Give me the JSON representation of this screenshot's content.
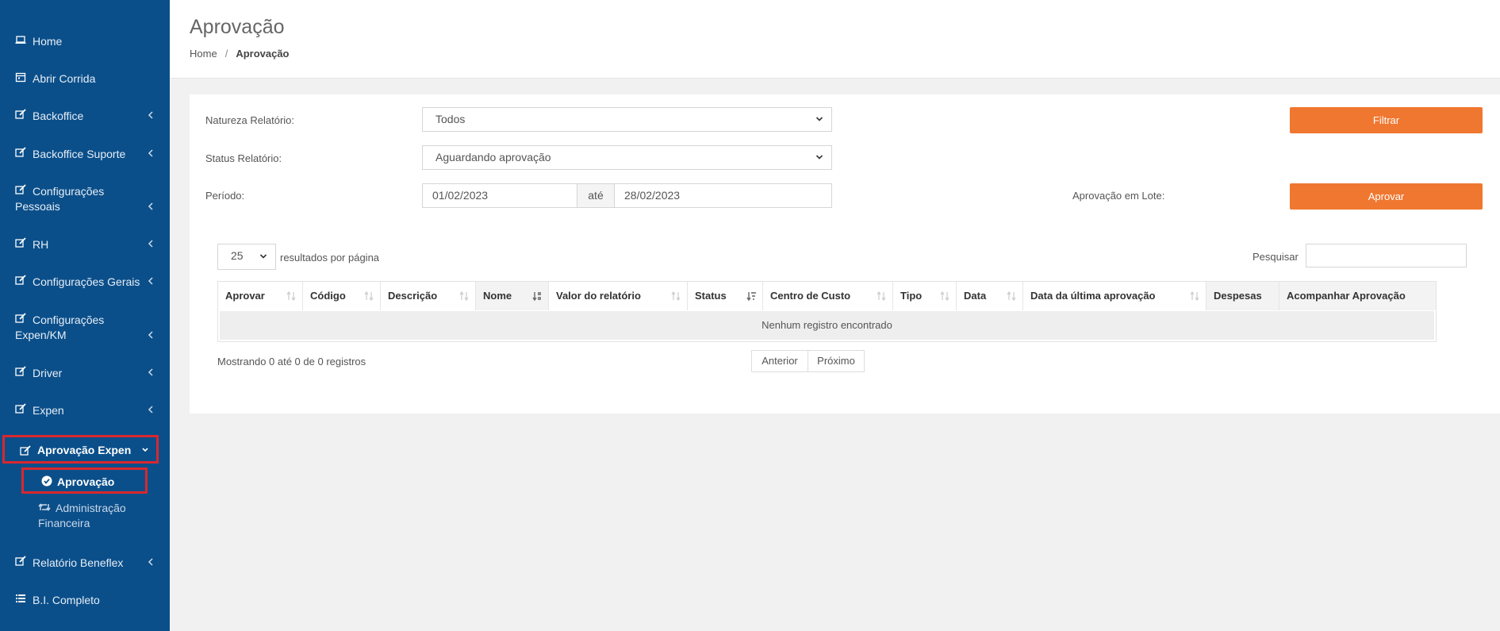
{
  "sidebar": {
    "items": [
      {
        "label": "Home",
        "icon": "laptop-icon"
      },
      {
        "label": "Abrir Corrida",
        "icon": "calendar-icon"
      },
      {
        "label": "Backoffice",
        "icon": "edit-icon"
      },
      {
        "label": "Backoffice Suporte",
        "icon": "edit-icon"
      },
      {
        "label": "Configurações Pessoais",
        "icon": "edit-icon"
      },
      {
        "label": "RH",
        "icon": "edit-icon"
      },
      {
        "label": "Configurações Gerais",
        "icon": "edit-icon"
      },
      {
        "label": "Configurações Expen/KM",
        "icon": "edit-icon"
      },
      {
        "label": "Driver",
        "icon": "edit-icon"
      },
      {
        "label": "Expen",
        "icon": "edit-icon"
      },
      {
        "label": "Aprovação Expen",
        "icon": "edit-icon"
      },
      {
        "label": "Relatório Beneflex",
        "icon": "edit-icon"
      },
      {
        "label": "B.I. Completo",
        "icon": "list-icon"
      }
    ],
    "subitems": [
      {
        "label": "Aprovação",
        "icon": "check-circle-icon"
      },
      {
        "label": "Administração Financeira",
        "icon": "retweet-icon"
      }
    ]
  },
  "header": {
    "title": "Aprovação",
    "breadcrumb": {
      "home": "Home",
      "separator": "/",
      "current": "Aprovação"
    }
  },
  "filters": {
    "natureza_label": "Natureza Relatório:",
    "natureza_value": "Todos",
    "status_label": "Status Relatório:",
    "status_value": "Aguardando aprovação",
    "periodo_label": "Período:",
    "periodo_start": "01/02/2023",
    "periodo_sep": "até",
    "periodo_end": "28/02/2023",
    "lote_label": "Aprovação em Lote:",
    "filter_button": "Filtrar",
    "approve_button": "Aprovar"
  },
  "table": {
    "page_size": "25",
    "page_size_label": "resultados por página",
    "search_label": "Pesquisar",
    "search_value": "",
    "columns": [
      "Aprovar",
      "Código",
      "Descrição",
      "Nome",
      "Valor do relatório",
      "Status",
      "Centro de Custo",
      "Tipo",
      "Data",
      "Data da última aprovação",
      "Despesas",
      "Acompanhar Aprovação"
    ],
    "empty_message": "Nenhum registro encontrado",
    "info": "Mostrando 0 até 0 de 0 registros",
    "prev": "Anterior",
    "next": "Próximo"
  },
  "colors": {
    "sidebar": "#0b4f8a",
    "accent": "#f07730",
    "highlight": "#d9272e"
  }
}
